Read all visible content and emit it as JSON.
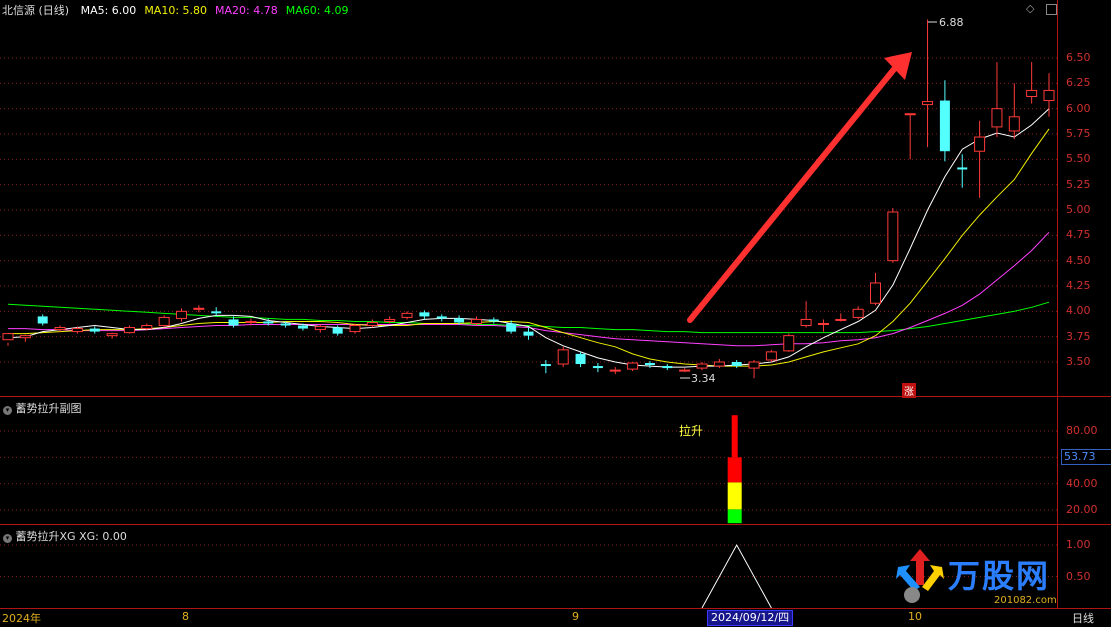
{
  "header": {
    "title": "北信源 (日线)",
    "ma": [
      {
        "label": "MA5:",
        "value": "6.00",
        "color": "#ffffff"
      },
      {
        "label": "MA10:",
        "value": "5.80",
        "color": "#f0f000"
      },
      {
        "label": "MA20:",
        "value": "4.78",
        "color": "#ff40ff"
      },
      {
        "label": "MA60:",
        "value": "4.09",
        "color": "#00ff00"
      }
    ]
  },
  "sub1": {
    "title": "蓄势拉升副图",
    "current_value": "53.73",
    "signal_label": "拉升"
  },
  "sub2": {
    "title": "蓄势拉升XG",
    "xg_label": "XG:",
    "xg_value": "0.00"
  },
  "annotations": {
    "high": "6.88",
    "low": "3.34",
    "rise_marker": "涨"
  },
  "xaxis": {
    "labels": [
      "2024年",
      "8",
      "9",
      "10"
    ],
    "cursor_date": "2024/09/12/四",
    "period": "日线"
  },
  "logo": {
    "text": "万股网",
    "url": "201082.com"
  },
  "colors": {
    "up": "#ff3a3a",
    "down": "#54ffff",
    "ma5": "#ffffff",
    "ma10": "#f0f000",
    "ma20": "#ff40ff",
    "ma60": "#00ff00",
    "grid": "#8a1a1a"
  },
  "chart_data": [
    {
      "type": "candlestick",
      "title": "北信源 (日线)",
      "ylim": [
        3.3,
        6.9
      ],
      "yticks": [
        "6.50",
        "6.25",
        "6.00",
        "5.75",
        "5.50",
        "5.25",
        "5.00",
        "4.75",
        "4.50",
        "4.25",
        "4.00",
        "3.75",
        "3.50"
      ],
      "candles": [
        [
          3.72,
          3.78,
          3.69,
          3.66
        ],
        [
          3.74,
          3.76,
          3.77,
          3.7
        ],
        [
          3.95,
          3.88,
          3.97,
          3.86
        ],
        [
          3.82,
          3.84,
          3.86,
          3.8
        ],
        [
          3.8,
          3.83,
          3.85,
          3.78
        ],
        [
          3.83,
          3.8,
          3.85,
          3.78
        ],
        [
          3.76,
          3.78,
          3.79,
          3.73
        ],
        [
          3.79,
          3.84,
          3.86,
          3.78
        ],
        [
          3.83,
          3.86,
          3.88,
          3.81
        ],
        [
          3.86,
          3.94,
          3.96,
          3.84
        ],
        [
          3.93,
          4.0,
          4.03,
          3.9
        ],
        [
          4.02,
          4.03,
          4.06,
          3.99
        ],
        [
          4.0,
          3.98,
          4.04,
          3.95
        ],
        [
          3.92,
          3.86,
          3.95,
          3.84
        ],
        [
          3.89,
          3.9,
          3.93,
          3.86
        ],
        [
          3.9,
          3.88,
          3.93,
          3.86
        ],
        [
          3.88,
          3.86,
          3.9,
          3.84
        ],
        [
          3.86,
          3.83,
          3.88,
          3.81
        ],
        [
          3.82,
          3.85,
          3.87,
          3.79
        ],
        [
          3.84,
          3.78,
          3.86,
          3.76
        ],
        [
          3.8,
          3.86,
          3.88,
          3.78
        ],
        [
          3.86,
          3.89,
          3.92,
          3.84
        ],
        [
          3.9,
          3.92,
          3.95,
          3.88
        ],
        [
          3.94,
          3.98,
          4.0,
          3.92
        ],
        [
          3.99,
          3.95,
          4.01,
          3.92
        ],
        [
          3.95,
          3.93,
          3.97,
          3.9
        ],
        [
          3.93,
          3.89,
          3.96,
          3.87
        ],
        [
          3.88,
          3.92,
          3.95,
          3.86
        ],
        [
          3.92,
          3.9,
          3.94,
          3.88
        ],
        [
          3.88,
          3.8,
          3.91,
          3.78
        ],
        [
          3.8,
          3.76,
          3.84,
          3.72
        ],
        [
          3.48,
          3.46,
          3.52,
          3.39
        ],
        [
          3.48,
          3.62,
          3.65,
          3.45
        ],
        [
          3.58,
          3.48,
          3.6,
          3.45
        ],
        [
          3.46,
          3.44,
          3.49,
          3.4
        ],
        [
          3.42,
          3.42,
          3.45,
          3.38
        ],
        [
          3.43,
          3.49,
          3.5,
          3.41
        ],
        [
          3.49,
          3.47,
          3.51,
          3.44
        ],
        [
          3.46,
          3.44,
          3.48,
          3.42
        ],
        [
          3.42,
          3.42,
          3.44,
          3.4
        ],
        [
          3.44,
          3.48,
          3.5,
          3.42
        ],
        [
          3.46,
          3.5,
          3.53,
          3.44
        ],
        [
          3.5,
          3.46,
          3.52,
          3.44
        ],
        [
          3.44,
          3.5,
          3.52,
          3.34
        ],
        [
          3.52,
          3.6,
          3.62,
          3.5
        ],
        [
          3.61,
          3.76,
          3.78,
          3.6
        ],
        [
          3.86,
          3.92,
          4.1,
          3.84
        ],
        [
          3.88,
          3.88,
          3.92,
          3.8
        ],
        [
          3.92,
          3.92,
          3.98,
          3.9
        ],
        [
          3.94,
          4.02,
          4.05,
          3.92
        ],
        [
          4.08,
          4.28,
          4.38,
          4.06
        ],
        [
          4.5,
          4.98,
          5.02,
          4.48
        ],
        [
          5.95,
          5.95,
          5.95,
          5.5
        ],
        [
          6.04,
          6.07,
          6.88,
          5.62
        ],
        [
          6.08,
          5.58,
          6.28,
          5.48
        ],
        [
          5.42,
          5.4,
          5.55,
          5.22
        ],
        [
          5.58,
          5.72,
          5.88,
          5.12
        ],
        [
          5.82,
          6.0,
          6.46,
          5.72
        ],
        [
          5.78,
          5.92,
          6.25,
          5.7
        ],
        [
          6.12,
          6.18,
          6.46,
          6.05
        ],
        [
          6.08,
          6.18,
          6.35,
          5.92
        ]
      ],
      "ma5": [
        3.74,
        3.75,
        3.8,
        3.82,
        3.84,
        3.86,
        3.84,
        3.82,
        3.82,
        3.84,
        3.88,
        3.93,
        3.96,
        3.96,
        3.95,
        3.91,
        3.89,
        3.87,
        3.85,
        3.84,
        3.83,
        3.84,
        3.86,
        3.89,
        3.92,
        3.93,
        3.93,
        3.92,
        3.91,
        3.88,
        3.85,
        3.74,
        3.66,
        3.6,
        3.54,
        3.5,
        3.47,
        3.46,
        3.45,
        3.45,
        3.46,
        3.46,
        3.47,
        3.48,
        3.5,
        3.55,
        3.65,
        3.74,
        3.82,
        3.9,
        4.01,
        4.26,
        4.62,
        5.0,
        5.33,
        5.6,
        5.7,
        5.76,
        5.72,
        5.84,
        6.0
      ],
      "ma10": [
        3.78,
        3.78,
        3.79,
        3.8,
        3.81,
        3.82,
        3.82,
        3.82,
        3.83,
        3.84,
        3.86,
        3.88,
        3.89,
        3.89,
        3.89,
        3.89,
        3.9,
        3.9,
        3.9,
        3.89,
        3.87,
        3.86,
        3.86,
        3.86,
        3.88,
        3.88,
        3.88,
        3.89,
        3.9,
        3.9,
        3.89,
        3.84,
        3.79,
        3.74,
        3.69,
        3.65,
        3.58,
        3.53,
        3.5,
        3.48,
        3.47,
        3.46,
        3.46,
        3.46,
        3.47,
        3.5,
        3.55,
        3.6,
        3.64,
        3.68,
        3.76,
        3.9,
        4.08,
        4.3,
        4.52,
        4.75,
        4.95,
        5.13,
        5.3,
        5.56,
        5.8
      ],
      "ma20": [
        3.83,
        3.83,
        3.82,
        3.82,
        3.81,
        3.81,
        3.81,
        3.81,
        3.82,
        3.83,
        3.84,
        3.85,
        3.86,
        3.86,
        3.87,
        3.87,
        3.87,
        3.87,
        3.87,
        3.87,
        3.87,
        3.87,
        3.87,
        3.87,
        3.87,
        3.87,
        3.87,
        3.86,
        3.86,
        3.85,
        3.84,
        3.81,
        3.79,
        3.77,
        3.75,
        3.73,
        3.72,
        3.71,
        3.7,
        3.69,
        3.68,
        3.67,
        3.66,
        3.66,
        3.67,
        3.68,
        3.68,
        3.69,
        3.71,
        3.72,
        3.74,
        3.78,
        3.84,
        3.91,
        3.98,
        4.06,
        4.17,
        4.31,
        4.45,
        4.6,
        4.78
      ],
      "ma60": [
        4.07,
        4.06,
        4.05,
        4.04,
        4.03,
        4.02,
        4.01,
        4.0,
        3.99,
        3.98,
        3.97,
        3.96,
        3.95,
        3.94,
        3.94,
        3.93,
        3.92,
        3.92,
        3.91,
        3.91,
        3.9,
        3.9,
        3.89,
        3.89,
        3.88,
        3.88,
        3.88,
        3.87,
        3.87,
        3.86,
        3.86,
        3.85,
        3.84,
        3.84,
        3.83,
        3.82,
        3.82,
        3.81,
        3.8,
        3.8,
        3.79,
        3.79,
        3.79,
        3.79,
        3.79,
        3.79,
        3.79,
        3.79,
        3.79,
        3.79,
        3.8,
        3.81,
        3.83,
        3.85,
        3.88,
        3.91,
        3.94,
        3.97,
        4.0,
        4.04,
        4.09
      ]
    },
    {
      "type": "bar",
      "title": "蓄势拉升副图",
      "ylim": [
        10,
        100
      ],
      "yticks": [
        "80.00",
        "60.00",
        "40.00",
        "20.00"
      ],
      "stacked_bar": {
        "index": 42,
        "segments": [
          {
            "from": 10,
            "to": 20.5,
            "color": "#00ff00"
          },
          {
            "from": 20.5,
            "to": 41,
            "color": "#ffff00"
          },
          {
            "from": 41,
            "to": 60,
            "color": "#ff0000"
          },
          {
            "from": 60,
            "to": 92,
            "color": "#ff0000"
          }
        ]
      }
    },
    {
      "type": "line",
      "title": "蓄势拉升XG",
      "ylim": [
        0,
        1.1
      ],
      "yticks": [
        "1.00",
        "0.50"
      ],
      "x": [
        40,
        42,
        44
      ],
      "values": [
        0,
        1,
        0
      ]
    }
  ]
}
